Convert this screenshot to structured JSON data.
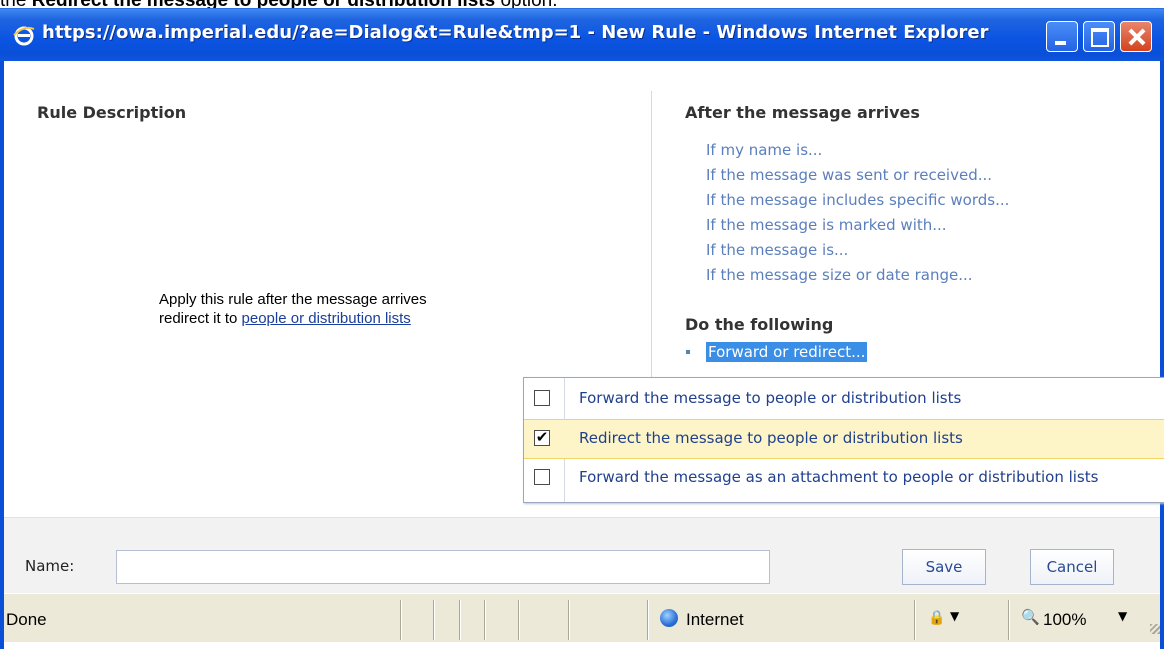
{
  "caption": {
    "prefix": "the ",
    "bold": "Redirect the message to people or distribution lists",
    "suffix": " option."
  },
  "window": {
    "title": "https://owa.imperial.edu/?ae=Dialog&t=Rule&tmp=1 - New Rule - Windows Internet Explorer"
  },
  "rule_description": {
    "heading": "Rule Description",
    "line1": "Apply this rule after the message arrives",
    "line2_prefix": "redirect it to ",
    "line2_link": "people or distribution lists"
  },
  "conditions": {
    "heading": "After the message arrives",
    "items": [
      "If my name is...",
      "If the message was sent or received...",
      "If the message includes specific words...",
      "If the message is marked with...",
      "If the message is...",
      "If the message size or date range..."
    ]
  },
  "actions": {
    "heading": "Do the following",
    "selected": "Forward or redirect..."
  },
  "menu": {
    "items": [
      {
        "label": "Forward the message to people or distribution lists",
        "checked": false
      },
      {
        "label": "Redirect the message to people or distribution lists",
        "checked": true
      },
      {
        "label": "Forward the message as an attachment to people or distribution lists",
        "checked": false
      }
    ]
  },
  "footer": {
    "name_label": "Name:",
    "name_value": "",
    "save_label": "Save",
    "cancel_label": "Cancel"
  },
  "status": {
    "text": "Done",
    "zone": "Internet",
    "zoom": "100%"
  }
}
